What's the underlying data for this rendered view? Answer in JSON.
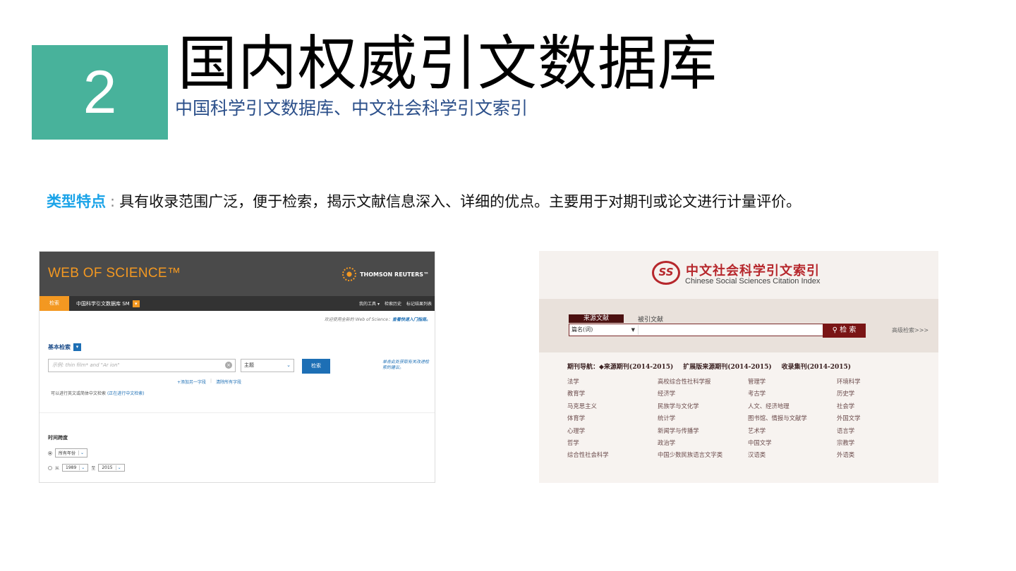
{
  "section": {
    "number": "2",
    "title": "国内权威引文数据库",
    "subtitle": "中国科学引文数据库、中文社会科学引文索引"
  },
  "description": {
    "label": "类型特点",
    "colon": ":",
    "text": "具有收录范围广泛，便于检索，揭示文献信息深入、详细的优点。主要用于对期刊或论文进行计量评价。"
  },
  "colors": {
    "accent_green": "#48b29b",
    "highlight_blue": "#1aa3e8",
    "wos_orange": "#f39821",
    "cssci_red": "#b6272c"
  },
  "wos": {
    "logo": "WEB OF SCIENCE™",
    "publisher": "THOMSON REUTERS™",
    "nav": {
      "search_tab": "检索",
      "database": "中国科学引文数据库 SM",
      "right_items": [
        "我的工具 ▾",
        "检索历史",
        "标记结果列表"
      ]
    },
    "welcome": "欢迎使用全新的 Web of Science：",
    "welcome_link": "查看快速入门指南。",
    "basic_search_label": "基本检索",
    "search_placeholder": "示例: thin film* and \"Ar ion\"",
    "field_select": "主题",
    "search_button": "检索",
    "side_tip": "单击此处获取有关改进检索的建议。",
    "links": [
      "+添加另一字段",
      "清除所有字段"
    ],
    "note_prefix": "可以进行英文或简体中文检索",
    "note_link": "(正在进行中文检索)",
    "timespan_label": "时间跨度",
    "timespan_all": "所有年份",
    "timespan_from_label": "从",
    "timespan_from": "1989",
    "timespan_to_label": "至",
    "timespan_to": "2015"
  },
  "cssci": {
    "logo_glyph": "SS",
    "title_zh": "中文社会科学引文索引",
    "title_en": "Chinese Social Sciences Citation Index",
    "tabs": [
      "来源文献",
      "被引文献"
    ],
    "field": "篇名(词)",
    "search_button": "检 索",
    "advanced": "高级检索>>>",
    "nav_label": "期刊导航：",
    "nav_groups": [
      "◆来源期刊(2014-2015)",
      "扩展版来源期刊(2014-2015)",
      "收录集刊(2014-2015)"
    ],
    "categories": [
      "法学",
      "高校综合性社科学报",
      "管理学",
      "环境科学",
      "教育学",
      "经济学",
      "考古学",
      "历史学",
      "马克思主义",
      "民族学与文化学",
      "人文、经济地理",
      "社会学",
      "体育学",
      "统计学",
      "图书馆、情报与文献学",
      "外国文学",
      "心理学",
      "新闻学与传播学",
      "艺术学",
      "语言学",
      "哲学",
      "政治学",
      "中国文学",
      "宗教学",
      "综合性社会科学",
      "中国少数民族语言文字类",
      "汉语类",
      "外语类"
    ]
  }
}
